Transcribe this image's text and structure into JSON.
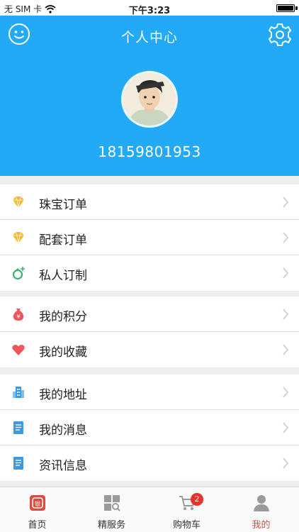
{
  "status_bar": {
    "carrier": "无 SIM 卡",
    "time": "下午3:23"
  },
  "header": {
    "title": "个人中心",
    "left_icon": "smile-icon",
    "right_icon": "gear-icon",
    "phone": "18159801953"
  },
  "groups": [
    {
      "items": [
        {
          "label": "珠宝订单",
          "icon": "diamond-icon"
        },
        {
          "label": "配套订单",
          "icon": "diamond-icon"
        },
        {
          "label": "私人订制",
          "icon": "custom-ring-icon"
        }
      ]
    },
    {
      "items": [
        {
          "label": "我的积分",
          "icon": "money-bag-icon"
        },
        {
          "label": "我的收藏",
          "icon": "heart-icon"
        }
      ]
    },
    {
      "items": [
        {
          "label": "我的地址",
          "icon": "building-icon"
        },
        {
          "label": "我的消息",
          "icon": "document-icon"
        },
        {
          "label": "资讯信息",
          "icon": "document-icon"
        }
      ]
    }
  ],
  "tabbar": {
    "tabs": [
      {
        "label": "首页",
        "icon": "home-icon"
      },
      {
        "label": "精服务",
        "icon": "grid-icon"
      },
      {
        "label": "购物车",
        "icon": "cart-icon"
      },
      {
        "label": "我的",
        "icon": "user-icon"
      }
    ],
    "active_index": 3,
    "cart_badge": "2"
  },
  "colors": {
    "header_bg": "#22aaf6",
    "active_tab": "#e04a3e",
    "badge": "#e8322a",
    "diamond": "#f5b82e",
    "heart": "#f0555d",
    "blue_icon": "#3a9be0"
  }
}
